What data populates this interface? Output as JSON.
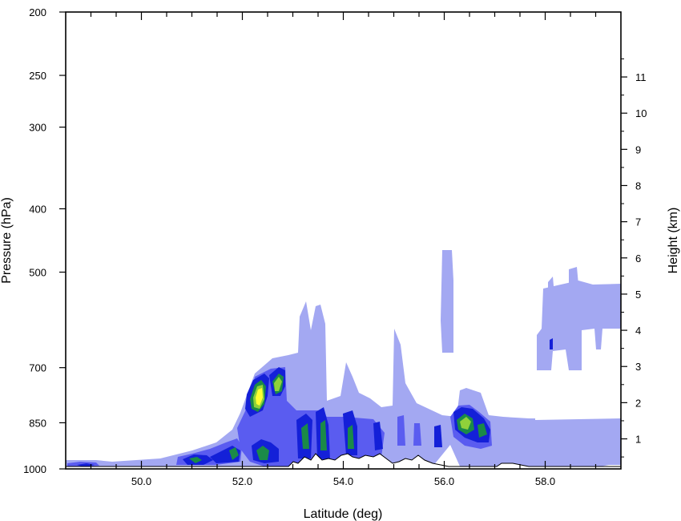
{
  "chart_data": {
    "type": "contour",
    "xlabel": "Latitude (deg)",
    "ylabel": "Pressure (hPa)",
    "y2label": "Height (km)",
    "xlim": [
      48.5,
      59.5
    ],
    "xticks": [
      {
        "value": 50.0,
        "label": "50.0"
      },
      {
        "value": 52.0,
        "label": "52.0"
      },
      {
        "value": 54.0,
        "label": "54.0"
      },
      {
        "value": 56.0,
        "label": "56.0"
      },
      {
        "value": 58.0,
        "label": "58.0"
      }
    ],
    "ylim": [
      1000,
      200
    ],
    "y_scale": "log-pressure",
    "yticks": [
      {
        "value": 200,
        "label": "200"
      },
      {
        "value": 250,
        "label": "250"
      },
      {
        "value": 300,
        "label": "300"
      },
      {
        "value": 400,
        "label": "400"
      },
      {
        "value": 500,
        "label": "500"
      },
      {
        "value": 700,
        "label": "700"
      },
      {
        "value": 850,
        "label": "850"
      },
      {
        "value": 1000,
        "label": "1000"
      }
    ],
    "y2ticks": [
      {
        "value": 1,
        "label": "1"
      },
      {
        "value": 2,
        "label": "2"
      },
      {
        "value": 3,
        "label": "3"
      },
      {
        "value": 4,
        "label": "4"
      },
      {
        "value": 5,
        "label": "5"
      },
      {
        "value": 6,
        "label": "6"
      },
      {
        "value": 7,
        "label": "7"
      },
      {
        "value": 8,
        "label": "8"
      },
      {
        "value": 9,
        "label": "9"
      },
      {
        "value": 10,
        "label": "10"
      },
      {
        "value": 11,
        "label": "11"
      }
    ],
    "contour_colors": [
      "#a3a8f2",
      "#5a5cf0",
      "#1420d8",
      "#1b8a48",
      "#8fd13a",
      "#ffff30"
    ],
    "grid": false,
    "legend": "none"
  }
}
